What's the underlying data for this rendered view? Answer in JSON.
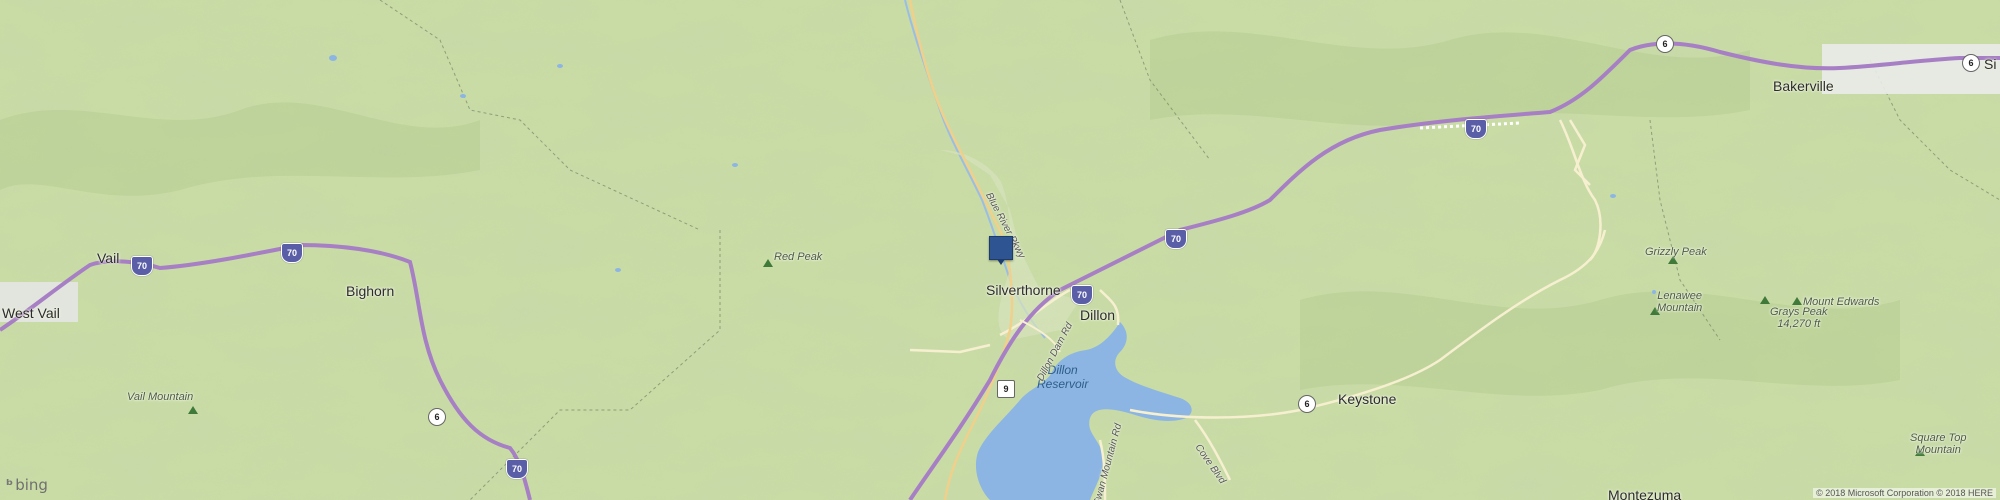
{
  "map": {
    "places": {
      "west_vail": "West Vail",
      "vail": "Vail",
      "bighorn": "Bighorn",
      "silverthorne": "Silverthorne",
      "dillon": "Dillon",
      "keystone": "Keystone",
      "bakerville": "Bakerville",
      "montezuma": "Montezuma",
      "si_partial": "Si"
    },
    "peaks": {
      "red_peak": "Red Peak",
      "vail_mountain": "Vail Mountain",
      "grizzly_peak": "Grizzly Peak",
      "lenawee": "Lenawee\nMountain",
      "grays_peak": "Grays Peak\n14,270 ft",
      "mount_edwards": "Mount Edwards",
      "square_top": "Square Top\nMountain"
    },
    "water": {
      "dillon_reservoir": "Dillon\nReservoir"
    },
    "roads": {
      "blue_river": "Blue River Pkwy",
      "dillon_dam": "Dillon Dam Rd",
      "swan_mountain": "Swan Mountain Rd",
      "cove_blvd": "Cove Blvd"
    },
    "shields": {
      "i70": "70",
      "us6": "6",
      "co9": "9"
    },
    "colors": {
      "terrain": "#c7dba2",
      "interstate": "#b98ed3",
      "water": "#8db5e3",
      "minor_road": "#f6efcf",
      "marker": "#2e5592"
    }
  },
  "attribution": {
    "logo": "bing",
    "copyright": "© 2018 Microsoft Corporation © 2018 HERE"
  }
}
